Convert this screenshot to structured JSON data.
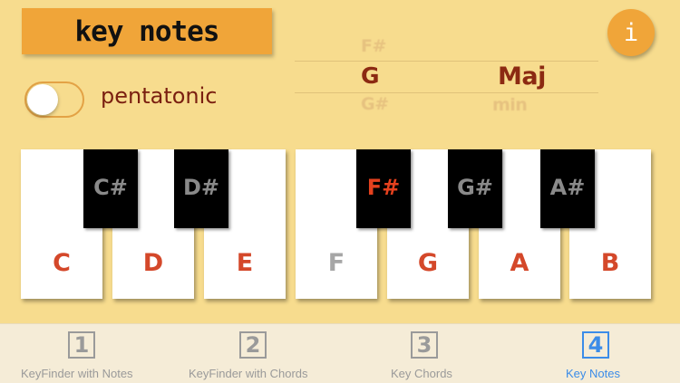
{
  "header": {
    "title": "key notes",
    "info_label": "i"
  },
  "options": {
    "pentatonic_label": "pentatonic",
    "pentatonic_on": false
  },
  "picker": {
    "root_above": "F#",
    "root_selected": "G",
    "root_below": "G#",
    "mode_selected": "Maj",
    "mode_below": "min"
  },
  "keyboard": {
    "white_keys": [
      {
        "label": "C",
        "in_key": true
      },
      {
        "label": "D",
        "in_key": true
      },
      {
        "label": "E",
        "in_key": true
      },
      {
        "label": "F",
        "in_key": false
      },
      {
        "label": "G",
        "in_key": true
      },
      {
        "label": "A",
        "in_key": true
      },
      {
        "label": "B",
        "in_key": true
      }
    ],
    "black_keys": [
      {
        "label": "C#",
        "in_key": false
      },
      {
        "label": "D#",
        "in_key": false
      },
      {
        "label": "F#",
        "in_key": true
      },
      {
        "label": "G#",
        "in_key": false
      },
      {
        "label": "A#",
        "in_key": false
      }
    ],
    "colors": {
      "in_key": "#d4482a",
      "out_of_key": "#a6a6a6",
      "black_in_key": "#e5411e",
      "black_out_of_key": "#8a8a8a"
    }
  },
  "tabs": [
    {
      "num": "1",
      "label": "KeyFinder with Notes",
      "active": false
    },
    {
      "num": "2",
      "label": "KeyFinder with Chords",
      "active": false
    },
    {
      "num": "3",
      "label": "Key Chords",
      "active": false
    },
    {
      "num": "4",
      "label": "Key Notes",
      "active": true
    }
  ],
  "accent_color": "#3b8ce8"
}
